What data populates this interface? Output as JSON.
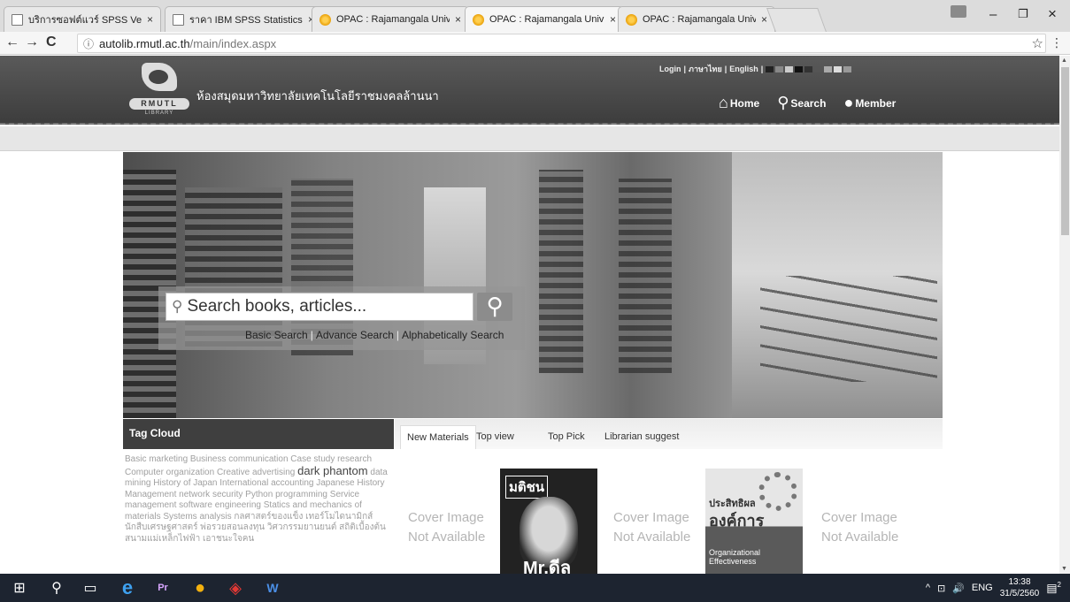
{
  "browser": {
    "tabs": [
      {
        "title": "บริการซอฟต์แวร์ SPSS Versi",
        "icon": "document-icon"
      },
      {
        "title": "ราคา IBM SPSS Statistics",
        "icon": "document-icon"
      },
      {
        "title": "OPAC : Rajamangala Univ",
        "icon": "opac-icon"
      },
      {
        "title": "OPAC : Rajamangala Univ",
        "icon": "opac-icon"
      },
      {
        "title": "OPAC : Rajamangala Univ",
        "icon": "opac-icon"
      }
    ],
    "active_tab": 3,
    "tab_close": "×",
    "window_controls": {
      "minimize": "–",
      "maximize": "❐",
      "close": "×"
    },
    "nav": {
      "back": "←",
      "forward": "→",
      "reload": "C"
    },
    "url": {
      "host": "autolib.rmutl.ac.th",
      "path": "/main/index.aspx",
      "info": "ⓘ"
    },
    "bookmark_star": "☆",
    "menu": "⋮"
  },
  "site": {
    "logo": {
      "text": "RMUTL",
      "sub": "LIBRARY"
    },
    "library_name": "ห้องสมุดมหาวิทยาลัยเทคโนโลยีราชมงคลล้านนา",
    "toplinks": {
      "login": "Login",
      "thai": "ภาษาไทย",
      "english": "English",
      "sep": "|"
    },
    "theme_swatches": [
      "#222222",
      "#888888",
      "#cccccc",
      "#111111",
      "#333333",
      "#555555",
      "#aaaaaa",
      "#dddddd",
      "#999999"
    ],
    "nav": [
      {
        "label": "Home",
        "icon": "home-icon",
        "glyph": "⌂"
      },
      {
        "label": "Search",
        "icon": "search-icon",
        "glyph": "⚲"
      },
      {
        "label": "Member",
        "icon": "member-icon",
        "glyph": "●"
      }
    ]
  },
  "search": {
    "placeholder": "Search books, articles...",
    "links": [
      "Basic Search",
      "Advance Search",
      "Alphabetically Search"
    ]
  },
  "tag_cloud": {
    "title": "Tag Cloud",
    "tags_before": "Basic marketing Business communication Case study research Computer organization Creative advertising",
    "tag_big": "dark phantom",
    "tags_after": "data mining History of Japan International accounting Japanese History Management network security Python programming Service management software engineering Statics and mechanics of materials Systems analysis กลศาสตร์ของแข็ง เทอร์โมไดนามิกส์ นักสืบเศรษฐศาสตร์ พ่อรวยสอนลงทุน วิศวกรรมยานยนต์ สถิติเบื้องต้น สนามแม่เหล็กไฟฟ้า เอาชนะใจคน"
  },
  "materials": {
    "tabs": [
      "New Materials",
      "Top view",
      "Top Pick",
      "Librarian suggest"
    ],
    "active_tab": 0,
    "cover_na": [
      "Cover Image",
      "Not Available"
    ],
    "book1": {
      "masthead": "มติชน",
      "caption": "Mr.ดีล"
    },
    "book2": {
      "title_small": "ประสิทธิผล",
      "title_big": "องค์การ",
      "subtitle": "Organizational Effectiveness"
    }
  },
  "taskbar": {
    "items": [
      {
        "name": "start-icon",
        "glyph": "⊞"
      },
      {
        "name": "cortana-search-icon",
        "glyph": "⚲"
      },
      {
        "name": "task-view-icon",
        "glyph": "▭"
      },
      {
        "name": "edge-icon",
        "glyph": "e"
      },
      {
        "name": "premiere-icon",
        "glyph": "Pr"
      },
      {
        "name": "chrome-icon",
        "glyph": "●"
      },
      {
        "name": "app-icon",
        "glyph": "◈"
      },
      {
        "name": "word-icon",
        "glyph": "W"
      }
    ],
    "tray": {
      "chevron": "^",
      "net": "⊡",
      "volume": "🔊",
      "lang": "ENG",
      "time": "13:38",
      "date": "31/5/2560",
      "notif": "2"
    }
  }
}
